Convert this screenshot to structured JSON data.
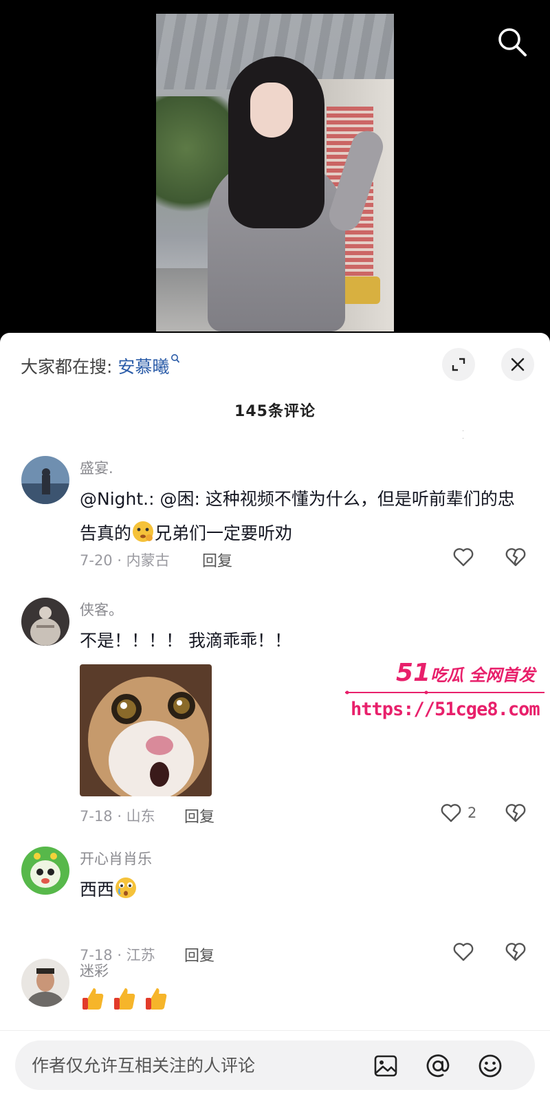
{
  "video": {
    "search_icon": "search-icon"
  },
  "sheet": {
    "trending_label": "大家都在搜:",
    "trending_keyword": "安慕曦",
    "comment_count": "145条评论",
    "icons": {
      "expand": "expand-icon",
      "close": "close-icon"
    }
  },
  "comments": [
    {
      "user": "盛宴.",
      "text_before": "@Night.: @困: 这种视频不懂为什么，但是听前辈们的忠告真的",
      "text_after": "兄弟们一定要听劝",
      "meta": "7-20 · 内蒙古",
      "reply": "回复",
      "likes": ""
    },
    {
      "user": "侠客。",
      "text": "不是！！！！ 我滴乖乖！！",
      "meta": "7-18 · 山东",
      "reply": "回复",
      "likes": "2"
    },
    {
      "user": "开心肖肖乐",
      "text": "西西",
      "meta": "7-18 · 江苏",
      "reply": "回复",
      "likes": ""
    },
    {
      "user": "迷彩",
      "emoji": "thumbs-up ×3"
    }
  ],
  "watermark": {
    "title_num": "51",
    "title_text": "吃瓜 全网首发",
    "url": "https://51cge8.com"
  },
  "input": {
    "placeholder": "作者仅允许互相关注的人评论",
    "icons": [
      "image-icon",
      "at-icon",
      "emoji-icon"
    ]
  },
  "colors": {
    "keyword": "#2b5ca8",
    "watermark": "#e8206b",
    "sheet_bg": "#ffffff",
    "top_bg": "#000000"
  }
}
